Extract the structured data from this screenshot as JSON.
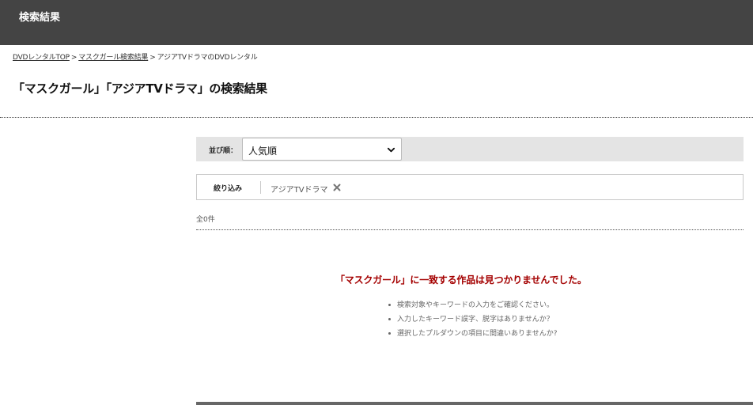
{
  "header": {
    "title": "検索結果"
  },
  "breadcrumb": {
    "items": [
      "DVDレンタルTOP",
      "マスクガール検索結果",
      "アジアTVドラマのDVDレンタル"
    ],
    "separator": ">"
  },
  "page": {
    "title": "「マスクガール」「アジアTVドラマ」の検索結果"
  },
  "sort": {
    "label": "並び順：",
    "selected": "人気順"
  },
  "filter": {
    "label": "絞り込み",
    "chip": "アジアTVドラマ"
  },
  "results": {
    "count_text": "全0件"
  },
  "empty_state": {
    "message": "「マスクガール」に一致する作品は見つかりませんでした。",
    "tips": [
      "検索対象やキーワードの入力をご確認ください。",
      "入力したキーワード誤字、脱字はありませんか？",
      "選択したプルダウンの項目に間違いありませんか?"
    ]
  },
  "colors": {
    "header_bg": "#444444",
    "sort_bar_bg": "#e4e4e4",
    "alert_text": "#a40000"
  }
}
